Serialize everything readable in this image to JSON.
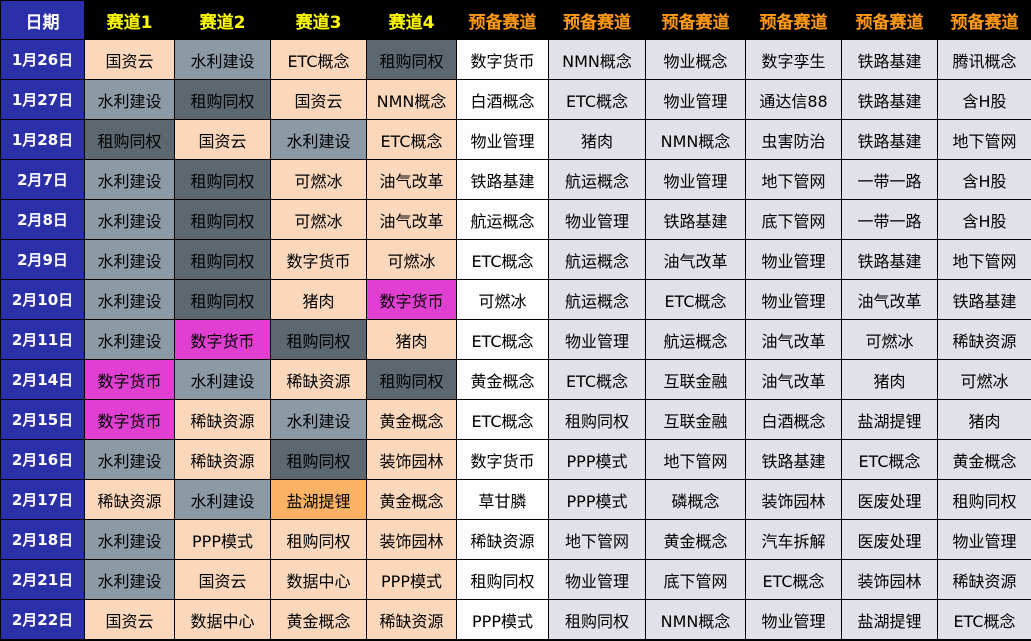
{
  "headers": {
    "date": "日期",
    "tracks": [
      "赛道1",
      "赛道2",
      "赛道3",
      "赛道4"
    ],
    "backups": [
      "预备赛道",
      "预备赛道",
      "预备赛道",
      "预备赛道",
      "预备赛道",
      "预备赛道"
    ]
  },
  "legend_colors": {
    "date": "#2b2fa8",
    "peach": "#fbd8bc",
    "gray": "#8c9aa6",
    "dark": "#5c6770",
    "magenta": "#e03fd2",
    "orange": "#fbb264",
    "light": "#fdfdfd",
    "backup": "#e1e2e9",
    "track_header_text": "#ffff00",
    "backup_header_text": "#ff9a16"
  },
  "rows": [
    {
      "date": "1月26日",
      "tracks": [
        "国资云",
        "水利建设",
        "ETC概念",
        "租购同权"
      ],
      "backups": [
        "数字货币",
        "NMN概念",
        "物业概念",
        "数字孪生",
        "铁路基建",
        "腾讯概念"
      ]
    },
    {
      "date": "1月27日",
      "tracks": [
        "水利建设",
        "租购同权",
        "国资云",
        "NMN概念"
      ],
      "backups": [
        "白酒概念",
        "ETC概念",
        "物业管理",
        "通达信88",
        "铁路基建",
        "含H股"
      ]
    },
    {
      "date": "1月28日",
      "tracks": [
        "租购同权",
        "国资云",
        "水利建设",
        "ETC概念"
      ],
      "backups": [
        "物业管理",
        "猪肉",
        "NMN概念",
        "虫害防治",
        "铁路基建",
        "地下管网"
      ]
    },
    {
      "date": "2月7日",
      "tracks": [
        "水利建设",
        "租购同权",
        "可燃冰",
        "油气改革"
      ],
      "backups": [
        "铁路基建",
        "航运概念",
        "物业管理",
        "地下管网",
        "一带一路",
        "含H股"
      ]
    },
    {
      "date": "2月8日",
      "tracks": [
        "水利建设",
        "租购同权",
        "可燃冰",
        "油气改革"
      ],
      "backups": [
        "航运概念",
        "物业管理",
        "铁路基建",
        "底下管网",
        "一带一路",
        "含H股"
      ]
    },
    {
      "date": "2月9日",
      "tracks": [
        "水利建设",
        "租购同权",
        "数字货币",
        "可燃冰"
      ],
      "backups": [
        "ETC概念",
        "航运概念",
        "油气改革",
        "物业管理",
        "铁路基建",
        "地下管网"
      ]
    },
    {
      "date": "2月10日",
      "tracks": [
        "水利建设",
        "租购同权",
        "猪肉",
        "数字货币"
      ],
      "backups": [
        "可燃冰",
        "航运概念",
        "ETC概念",
        "物业管理",
        "油气改革",
        "铁路基建"
      ]
    },
    {
      "date": "2月11日",
      "tracks": [
        "水利建设",
        "数字货币",
        "租购同权",
        "猪肉"
      ],
      "backups": [
        "ETC概念",
        "物业管理",
        "航运概念",
        "油气改革",
        "可燃冰",
        "稀缺资源"
      ]
    },
    {
      "date": "2月14日",
      "tracks": [
        "数字货币",
        "水利建设",
        "稀缺资源",
        "租购同权"
      ],
      "backups": [
        "黄金概念",
        "ETC概念",
        "互联金融",
        "油气改革",
        "猪肉",
        "可燃冰"
      ]
    },
    {
      "date": "2月15日",
      "tracks": [
        "数字货币",
        "稀缺资源",
        "水利建设",
        "黄金概念"
      ],
      "backups": [
        "ETC概念",
        "租购同权",
        "互联金融",
        "白酒概念",
        "盐湖提锂",
        "猪肉"
      ]
    },
    {
      "date": "2月16日",
      "tracks": [
        "水利建设",
        "稀缺资源",
        "租购同权",
        "装饰园林"
      ],
      "backups": [
        "数字货币",
        "PPP模式",
        "地下管网",
        "铁路基建",
        "ETC概念",
        "黄金概念"
      ]
    },
    {
      "date": "2月17日",
      "tracks": [
        "稀缺资源",
        "水利建设",
        "盐湖提锂",
        "黄金概念"
      ],
      "backups": [
        "草甘膦",
        "PPP模式",
        "磷概念",
        "装饰园林",
        "医废处理",
        "租购同权"
      ]
    },
    {
      "date": "2月18日",
      "tracks": [
        "水利建设",
        "PPP模式",
        "租购同权",
        "装饰园林"
      ],
      "backups": [
        "稀缺资源",
        "地下管网",
        "黄金概念",
        "汽车拆解",
        "医废处理",
        "物业管理"
      ]
    },
    {
      "date": "2月21日",
      "tracks": [
        "水利建设",
        "国资云",
        "数据中心",
        "PPP模式"
      ],
      "backups": [
        "租购同权",
        "物业管理",
        "底下管网",
        "ETC概念",
        "装饰园林",
        "稀缺资源"
      ]
    },
    {
      "date": "2月22日",
      "tracks": [
        "国资云",
        "数据中心",
        "黄金概念",
        "稀缺资源"
      ],
      "backups": [
        "PPP模式",
        "租购同权",
        "NMN概念",
        "物业管理",
        "盐湖提锂",
        "ETC概念"
      ]
    }
  ]
}
